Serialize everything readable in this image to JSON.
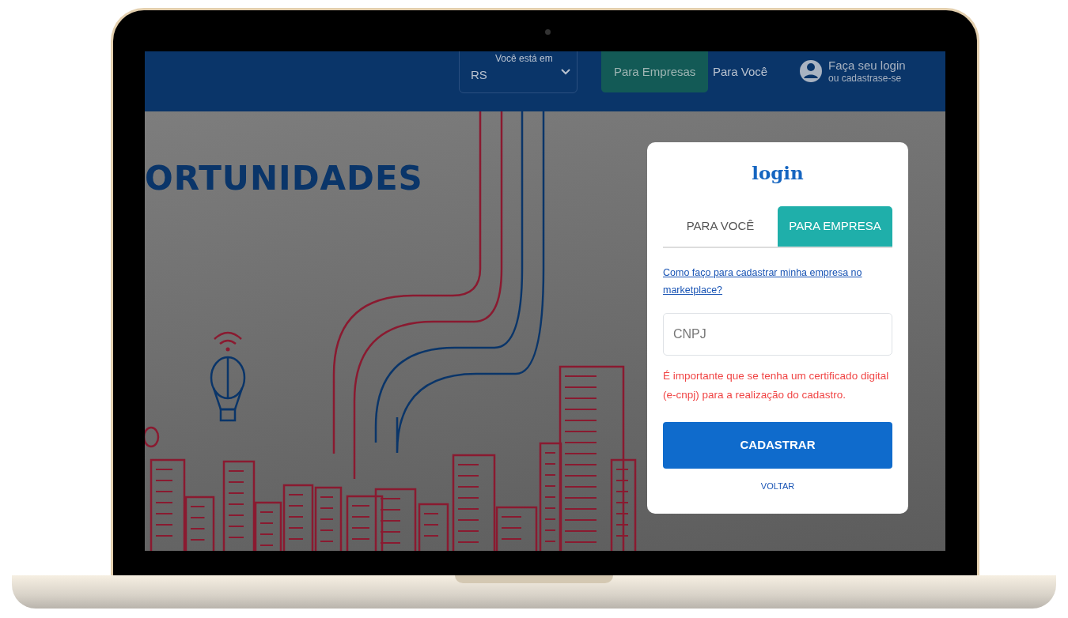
{
  "header": {
    "location": {
      "label": "Você está em",
      "value": "RS"
    },
    "nav": [
      {
        "label": "Para Empresas",
        "selected": true
      },
      {
        "label": "Para Você",
        "selected": false
      }
    ],
    "login": {
      "title": "Faça seu login",
      "subtitle": "ou cadastrase-se"
    }
  },
  "hero": {
    "title": "ORTUNIDADES"
  },
  "modal": {
    "title": "login",
    "tabs": [
      {
        "label": "PARA VOCÊ",
        "selected": false
      },
      {
        "label": "PARA EMPRESA",
        "selected": true
      }
    ],
    "help_link": "Como faço para cadastrar minha empresa no marketplace?",
    "cnpj": {
      "placeholder": "CNPJ"
    },
    "notice": "É importante que se tenha um certificado digital (e-cnpj) para a realização do cadastro.",
    "submit": "CADASTRAR",
    "back": "VOLTAR"
  }
}
